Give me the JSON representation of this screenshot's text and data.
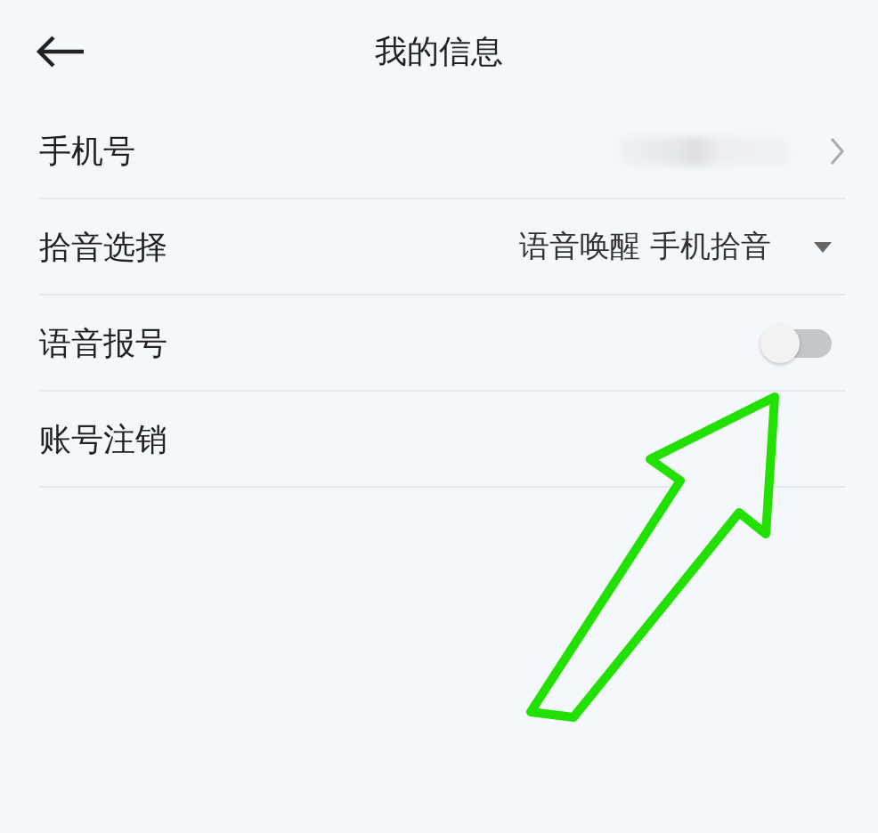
{
  "header": {
    "title": "我的信息"
  },
  "rows": [
    {
      "kind": "link",
      "label": "手机号"
    },
    {
      "kind": "select",
      "label": "拾音选择",
      "value": "语音唤醒 手机拾音"
    },
    {
      "kind": "toggle",
      "label": "语音报号",
      "on": false
    },
    {
      "kind": "plain",
      "label": "账号注销"
    }
  ]
}
